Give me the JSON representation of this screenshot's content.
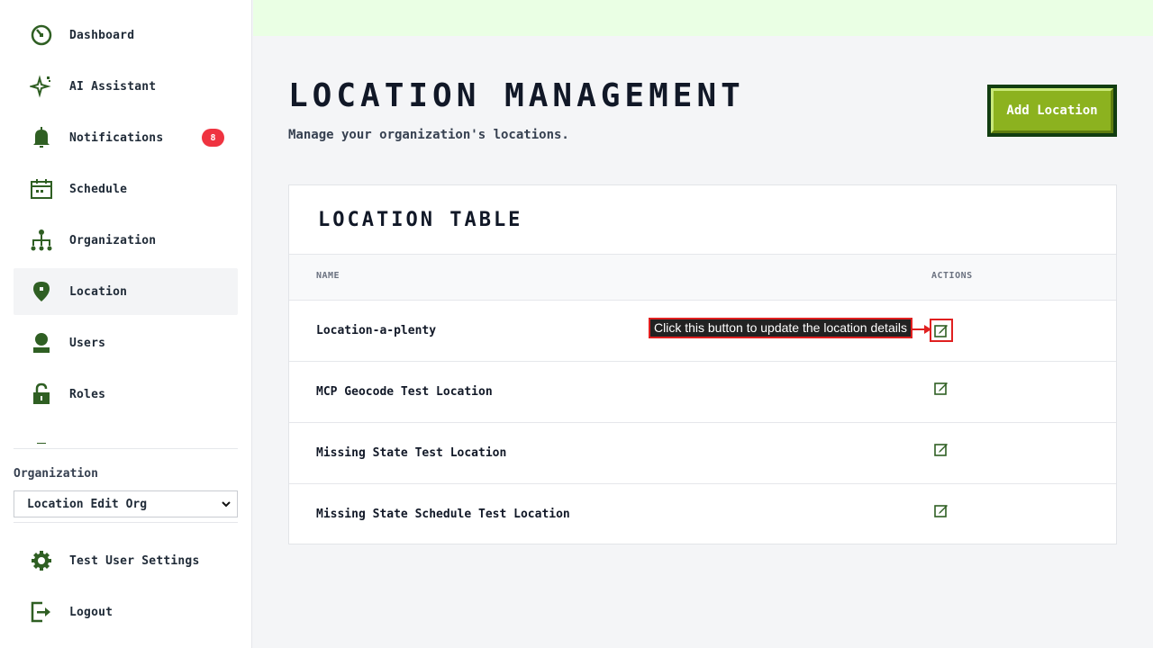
{
  "sidebar": {
    "items": [
      {
        "label": "Dashboard",
        "icon": "dashboard-icon"
      },
      {
        "label": "AI Assistant",
        "icon": "sparkle-icon"
      },
      {
        "label": "Notifications",
        "icon": "bell-icon",
        "badge": "8"
      },
      {
        "label": "Schedule",
        "icon": "calendar-icon"
      },
      {
        "label": "Organization",
        "icon": "org-chart-icon"
      },
      {
        "label": "Location",
        "icon": "location-pin-icon",
        "active": true
      },
      {
        "label": "Users",
        "icon": "user-icon"
      },
      {
        "label": "Roles",
        "icon": "lock-icon"
      }
    ],
    "org_label": "Organization",
    "org_selected": "Location Edit Org",
    "bottom": [
      {
        "label": "Test User Settings",
        "icon": "gear-icon"
      },
      {
        "label": "Logout",
        "icon": "logout-icon"
      }
    ]
  },
  "header": {
    "title": "LOCATION MANAGEMENT",
    "subtitle": "Manage your organization's locations.",
    "add_label": "Add Location"
  },
  "table": {
    "title": "LOCATION TABLE",
    "columns": [
      "NAME",
      "ACTIONS"
    ],
    "rows": [
      {
        "name": "Location-a-plenty"
      },
      {
        "name": "MCP Geocode Test Location"
      },
      {
        "name": "Missing State Test Location"
      },
      {
        "name": "Missing State Schedule Test Location"
      }
    ]
  },
  "annotation": {
    "text": "Click this button to update the location details"
  },
  "colors": {
    "accent": "#8cb21f",
    "icon": "#2f5f23",
    "badge": "#ef3340",
    "highlight": "#e02020"
  }
}
